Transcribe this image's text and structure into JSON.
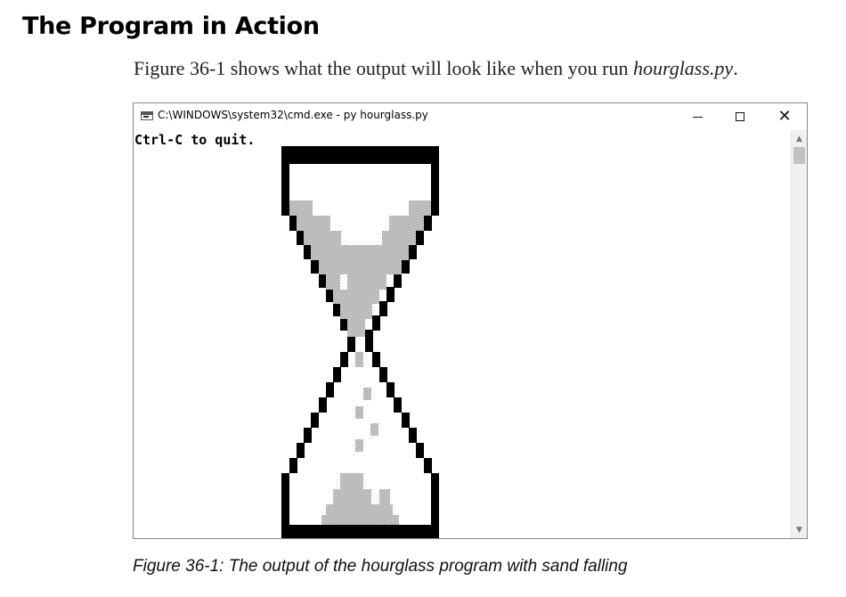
{
  "section": {
    "heading": "The Program in Action"
  },
  "intro": {
    "text_before": "Figure 36-1 shows what the output will look like when you run ",
    "filename": "hourglass.py",
    "text_after": "."
  },
  "window": {
    "title": "C:\\WINDOWS\\system32\\cmd.exe - py  hourglass.py",
    "console_text": "Ctrl-C to quit.",
    "icons": {
      "app": "cmd-icon",
      "minimize": "minimize-icon",
      "maximize": "maximize-icon",
      "close": "close-icon",
      "scroll_up": "chevron-up-icon",
      "scroll_down": "chevron-down-icon"
    }
  },
  "hourglass": {
    "frame_color": "#000000",
    "sand_color": "#a9a9a9"
  },
  "caption": "Figure 36-1: The output of the hourglass program with sand falling"
}
